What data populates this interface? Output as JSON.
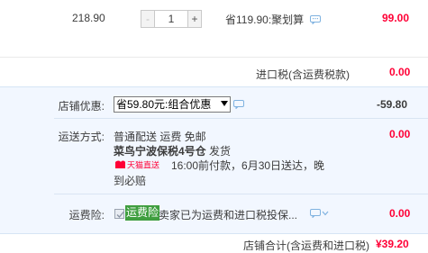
{
  "product": {
    "unit_price": "218.90",
    "quantity": "1",
    "minus_label": "-",
    "plus_label": "+",
    "discount_text": "省119.90:聚划算",
    "subtotal": "99.00"
  },
  "import_tax": {
    "label": "进口税(含运费税款)",
    "value": "0.00"
  },
  "store_discount": {
    "label": "店铺优惠:",
    "selected": "省59.80元:组合优惠",
    "value": "-59.80"
  },
  "shipping": {
    "label": "运送方式:",
    "line1": "普通配送 运费 免邮",
    "warehouse": "菜鸟宁波保税4号仓",
    "warehouse_suffix": " 发货",
    "badge_text": "天猫直送",
    "promise": "16:00前付款，6月30日送达，晚",
    "promise2": "到必赔",
    "value": "0.00"
  },
  "insurance": {
    "label": "运费险:",
    "tag": "运费险",
    "text": "卖家已为运费和进口税投保...",
    "value": "0.00"
  },
  "total": {
    "label": "店铺合计(含运费和进口税)",
    "value": "¥39.20"
  },
  "colors": {
    "price_red": "#ff0036",
    "section_bg": "#f2f7ff",
    "insurance_green": "#3f9e3f"
  }
}
